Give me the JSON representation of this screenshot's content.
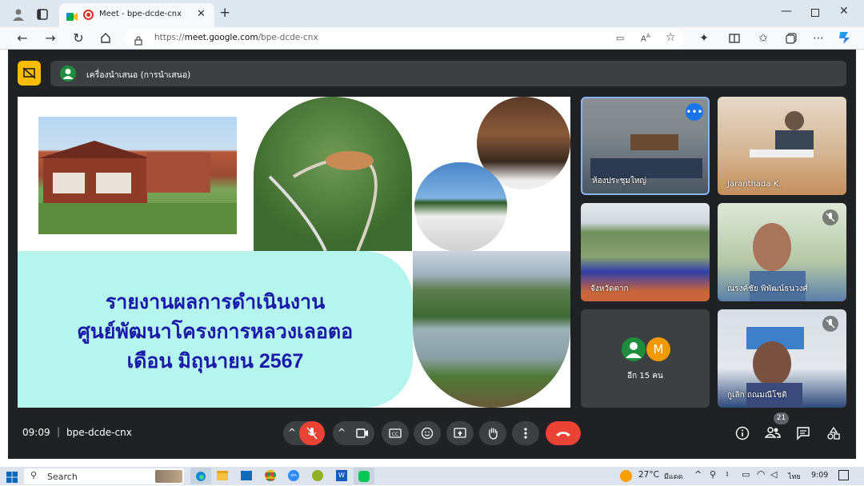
{
  "browser": {
    "tab_title": "Meet - bpe-dcde-cnx",
    "url_prefix": "https://",
    "url_host": "meet.google.com",
    "url_path": "/bpe-dcde-cnx"
  },
  "meet": {
    "presenter_label": "เครื่องนำเสนอ (การนำเสนอ)",
    "slide": {
      "line1": "รายงานผลการดำเนินงาน",
      "line2": "ศูนย์พัฒนาโครงการหลวงเลอตอ",
      "line3": "เดือน  มิถุนายน  2567"
    },
    "participants": [
      {
        "name": "ห้องประชุมใหญ่",
        "muted": false
      },
      {
        "name": "Jaranthada K.",
        "muted": false
      },
      {
        "name": "จังหวัดตาก",
        "muted": false
      },
      {
        "name": "ณรงค์ชัย พิพัฒน์ธนวงศ์",
        "muted": true
      },
      {
        "name": "อีก 15 คน",
        "muted": false
      },
      {
        "name": "กูเลิก ถณมณีโชติ",
        "muted": true
      }
    ],
    "others_avatar_letter": "M",
    "time": "09:09",
    "meeting_code": "bpe-dcde-cnx",
    "people_count": "21"
  },
  "taskbar": {
    "search_label": "Search",
    "weather": "27°C",
    "weather_desc": "มีแดด",
    "lang": "ไทย",
    "clock": "9:09"
  },
  "colors": {
    "meet_bg": "#202124",
    "tile_bg": "#3c4043",
    "end_call": "#ea4335",
    "slide_title": "#1a1aa8",
    "presenter_badge": "#fbbc04"
  }
}
